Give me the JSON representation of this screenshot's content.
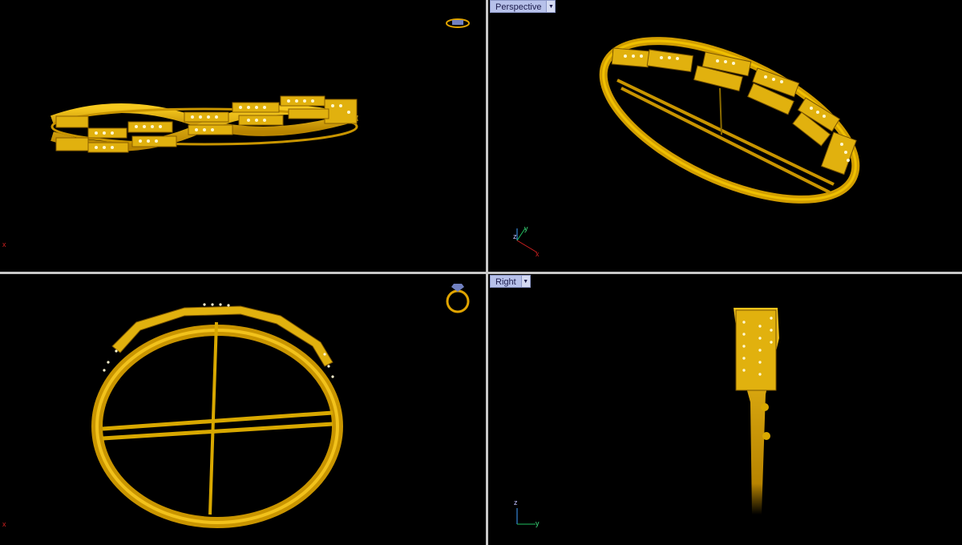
{
  "viewports": {
    "perspective": {
      "label": "Perspective"
    },
    "right": {
      "label": "Right"
    }
  },
  "axes": {
    "x": "x",
    "y": "y",
    "z": "z"
  },
  "colors": {
    "background": "#000000",
    "gold": "#d9a400",
    "gold_light": "#f2c21b",
    "divider": "#c8c8c8",
    "label_bg": "#b7c1ea"
  }
}
